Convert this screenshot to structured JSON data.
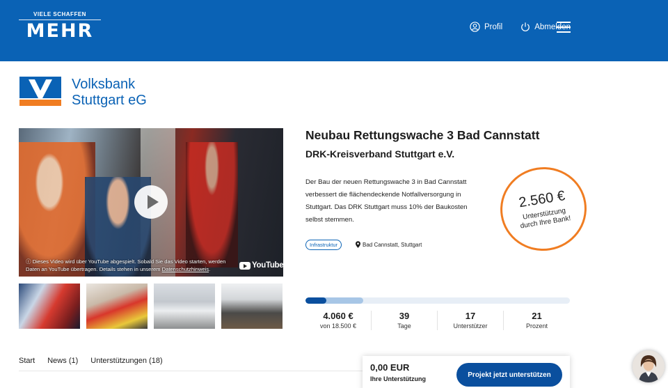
{
  "header": {
    "brand_small": "VIELE SCHAFFEN",
    "brand_big": "MEHR",
    "nav": [
      {
        "label": "Profil",
        "icon": "user-icon"
      },
      {
        "label": "Abmelden",
        "icon": "power-icon"
      }
    ],
    "menu_icon": "hamburger-menu-icon",
    "color": "#0a62b5"
  },
  "bank": {
    "name_line1": "Volksbank",
    "name_line2": "Stuttgart eG"
  },
  "video": {
    "notice_prefix": "ⓘ Dieses Video wird über YouTube abgespielt. Sobald Sie das Video starten, werden Daten an YouTube übertragen. Details stehen in unserem ",
    "notice_link": "Datenschutzhinweis",
    "notice_suffix": ".",
    "provider": "YouTube"
  },
  "project": {
    "title": "Neubau Rettungswache 3 Bad Cannstatt",
    "organization": "DRK-Kreisverband Stuttgart e.V.",
    "description": "Der Bau der neuen Rettungswache 3 in Bad Cannstatt verbessert die flächendeckende Notfallversorgung in Stuttgart. Das DRK Stuttgart muss 10% der Baukosten selbst stemmen.",
    "category": "Infrastruktur",
    "location": "Bad Cannstatt, Stuttgart"
  },
  "badge": {
    "amount": "2.560 €",
    "text": "Unterstützung durch Ihre Bank!",
    "color": "#f07d22"
  },
  "progress": {
    "funded_fraction": 0.078,
    "pledged_fraction": 0.219
  },
  "stats": [
    {
      "value": "4.060 €",
      "label": "von 18.500 €"
    },
    {
      "value": "39",
      "label": "Tage"
    },
    {
      "value": "17",
      "label": "Unterstützer"
    },
    {
      "value": "21",
      "label": "Prozent"
    }
  ],
  "tabs": [
    {
      "label": "Start"
    },
    {
      "label": "News",
      "count": "(1)"
    },
    {
      "label": "Unterstützungen",
      "count": "(18)"
    }
  ],
  "support": {
    "amount": "0,00 EUR",
    "label": "Ihre Unterstützung",
    "button": "Projekt jetzt unterstützen"
  }
}
